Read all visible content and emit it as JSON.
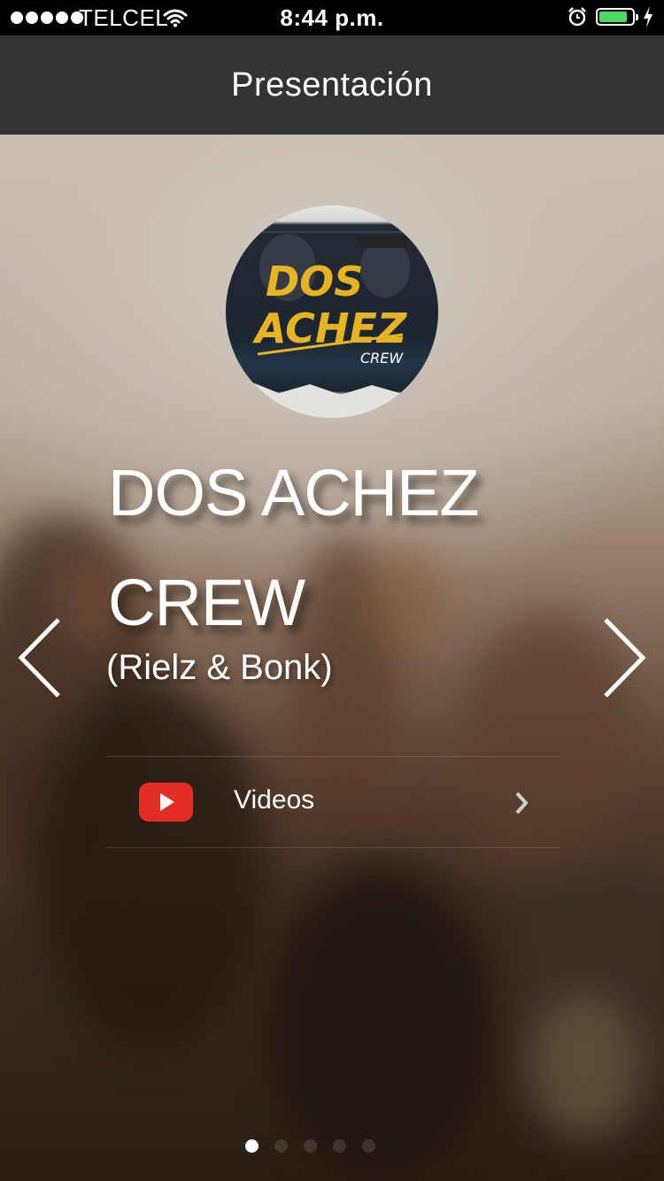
{
  "status_bar": {
    "signal_bars": 5,
    "carrier": "TELCEL",
    "time": "8:44 p.m.",
    "battery_level": 0.85,
    "battery_color": "#4cd964",
    "icons": [
      "signal-dots-icon",
      "wifi-icon",
      "alarm-icon",
      "battery-icon",
      "charging-bolt-icon"
    ]
  },
  "nav": {
    "title": "Presentación",
    "background": "#333333"
  },
  "hero": {
    "logo": {
      "line1": "DOS",
      "line2": "ACHEZ",
      "line3": "CREW",
      "accent": "#e6b422"
    },
    "title_line1": "DOS ACHEZ",
    "title_line2": "CREW",
    "subtitle": "(Rielz & Bonk)",
    "prev_icon": "chevron-left-icon",
    "next_icon": "chevron-right-icon"
  },
  "menu": {
    "items": [
      {
        "label": "Videos",
        "icon": "youtube-icon",
        "icon_color": "#e52d27",
        "chevron": "chevron-right-icon"
      }
    ]
  },
  "pager": {
    "count": 5,
    "active_index": 0
  }
}
